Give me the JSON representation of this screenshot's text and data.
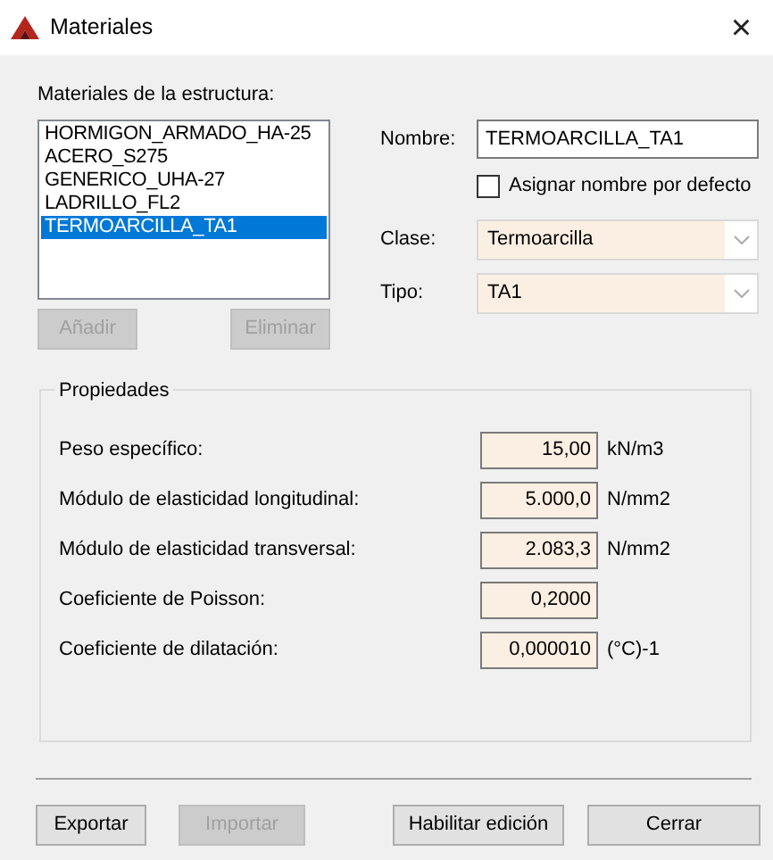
{
  "window": {
    "title": "Materiales",
    "close": "×"
  },
  "materials": {
    "label": "Materiales de la estructura:",
    "items": [
      {
        "name": "HORMIGON_ARMADO_HA-25",
        "selected": false
      },
      {
        "name": "ACERO_S275",
        "selected": false
      },
      {
        "name": "GENERICO_UHA-27",
        "selected": false
      },
      {
        "name": "LADRILLO_FL2",
        "selected": false
      },
      {
        "name": "TERMOARCILLA_TA1",
        "selected": true
      }
    ],
    "buttons": [
      {
        "label": "Añadir",
        "disabled": true
      },
      {
        "label": "Eliminar",
        "disabled": true
      }
    ]
  },
  "form": {
    "name_label": "Nombre:",
    "name_value": "TERMOARCILLA_TA1",
    "default_name": {
      "label": "Asignar nombre por defecto",
      "checked": false
    },
    "class_label": "Clase:",
    "class_value": "Termoarcilla",
    "type_label": "Tipo:",
    "type_value": "TA1"
  },
  "properties": {
    "title": "Propiedades",
    "rows": [
      {
        "label": "Peso específico:",
        "value": "15,00",
        "unit": "kN/m3"
      },
      {
        "label": "Módulo de elasticidad longitudinal:",
        "value": "5.000,0",
        "unit": "N/mm2"
      },
      {
        "label": "Módulo de elasticidad transversal:",
        "value": "2.083,3",
        "unit": "N/mm2"
      },
      {
        "label": "Coeficiente de Poisson:",
        "value": "0,2000"
      },
      {
        "label": "Coeficiente de dilatación:",
        "value": "0,000010",
        "unit": "(°C)-1"
      }
    ]
  },
  "footer": [
    {
      "label": "Exportar",
      "disabled": false
    },
    {
      "label": "Importar",
      "disabled": true
    },
    {
      "label": "Habilitar edición",
      "disabled": false
    },
    {
      "label": "Cerrar",
      "disabled": false
    }
  ]
}
